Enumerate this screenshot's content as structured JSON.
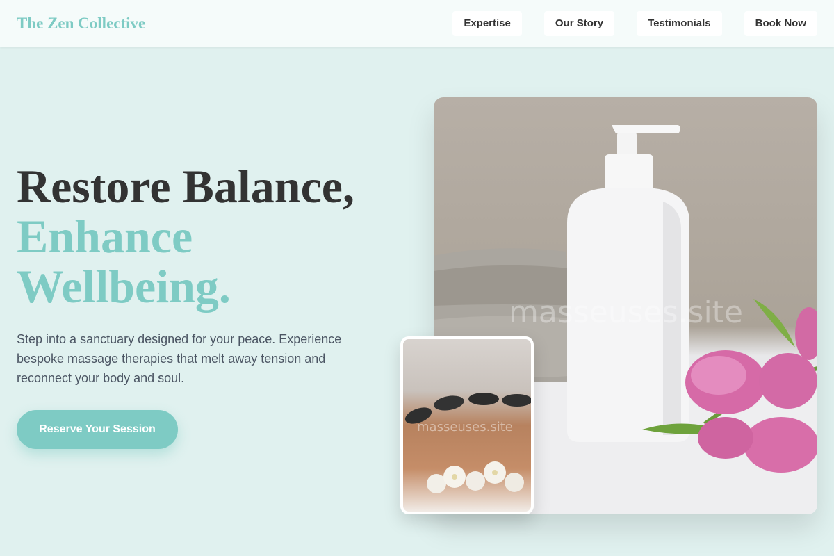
{
  "header": {
    "brand": "The Zen Collective",
    "nav": [
      {
        "label": "Expertise"
      },
      {
        "label": "Our Story"
      },
      {
        "label": "Testimonials"
      },
      {
        "label": "Book Now"
      }
    ]
  },
  "hero": {
    "title_line1": "Restore Balance,",
    "title_line2": "Enhance",
    "title_line3": "Wellbeing.",
    "description": "Step into a sanctuary designed for your peace. Experience bespoke massage therapies that melt away tension and reconnect your body and soul.",
    "cta_label": "Reserve Your Session"
  },
  "images": {
    "main_watermark": "masseuses.site",
    "inset_watermark": "masseuses.site"
  },
  "colors": {
    "accent": "#7ecbc4",
    "background": "#e0f1ef",
    "heading": "#333333",
    "body_text": "#4b5563"
  }
}
